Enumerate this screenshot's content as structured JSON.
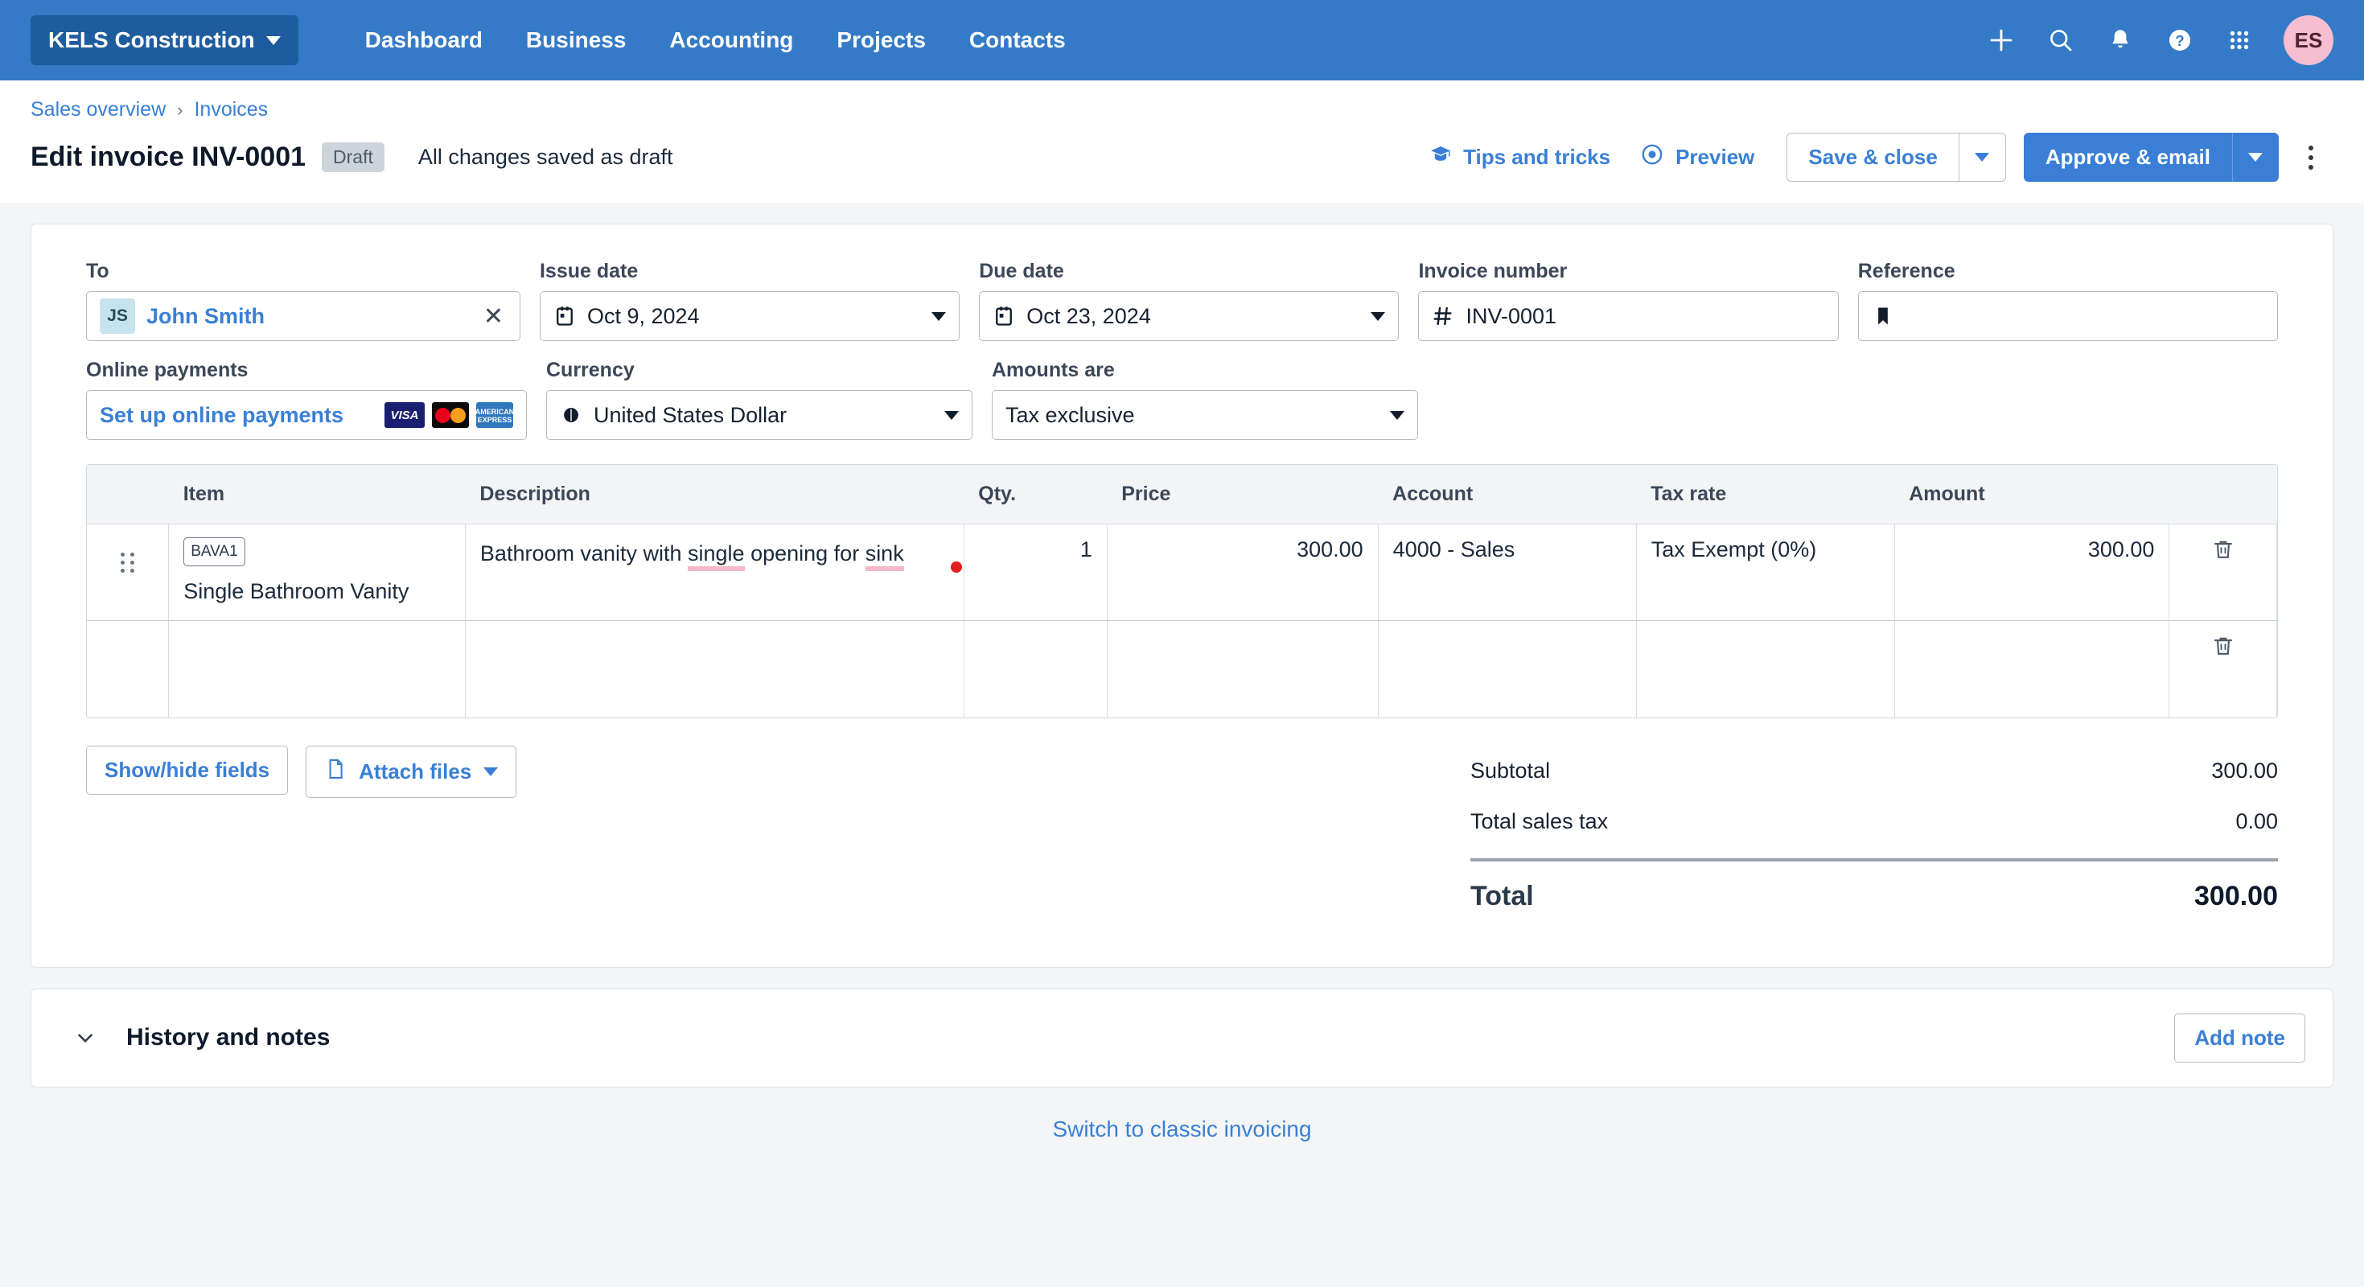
{
  "topnav": {
    "org_name": "KELS Construction",
    "links": [
      "Dashboard",
      "Business",
      "Accounting",
      "Projects",
      "Contacts"
    ],
    "icons": [
      "plus-icon",
      "search-icon",
      "notifications-bell-icon",
      "help-icon",
      "apps-grid-icon"
    ],
    "avatar_initials": "ES",
    "accent_bg": "#357ac6",
    "org_btn_bg": "#1f5c9e",
    "avatar_bg": "#f6bed0"
  },
  "header": {
    "breadcrumb": [
      "Sales overview",
      "Invoices"
    ],
    "breadcrumb_separator": "›",
    "title": "Edit invoice INV-0001",
    "status_badge": "Draft",
    "save_status": "All changes saved as draft",
    "tips_label": "Tips and tricks",
    "preview_label": "Preview",
    "save_close_label": "Save & close",
    "approve_email_label": "Approve & email"
  },
  "form": {
    "to": {
      "label": "To",
      "avatar_initials": "JS",
      "value": "John Smith",
      "clear": "✕"
    },
    "issue_date": {
      "label": "Issue date",
      "value": "Oct 9, 2024"
    },
    "due_date": {
      "label": "Due date",
      "value": "Oct 23, 2024"
    },
    "invoice_number": {
      "label": "Invoice number",
      "value": "INV-0001"
    },
    "reference": {
      "label": "Reference",
      "value": "",
      "placeholder": ""
    },
    "online_payments": {
      "label": "Online payments",
      "link": "Set up online payments",
      "cards": [
        "VISA",
        "Mastercard",
        "AMERICAN EXPRESS"
      ]
    },
    "currency": {
      "label": "Currency",
      "value": "United States Dollar"
    },
    "amounts_are": {
      "label": "Amounts are",
      "value": "Tax exclusive"
    }
  },
  "lines": {
    "headers": [
      "Item",
      "Description",
      "Qty.",
      "Price",
      "Account",
      "Tax rate",
      "Amount"
    ],
    "rows": [
      {
        "code": "BAVA1",
        "item": "Single Bathroom Vanity",
        "description_part1": "Bathroom vanity with ",
        "description_misspelled1": "single",
        "description_part2": " opening for ",
        "description_misspelled2": "sink",
        "qty": "1",
        "price": "300.00",
        "account": "4000 - Sales",
        "tax_rate": "Tax Exempt (0%)",
        "amount": "300.00"
      },
      {
        "code": "",
        "item": "",
        "description_part1": "",
        "description_misspelled1": "",
        "description_part2": "",
        "description_misspelled2": "",
        "qty": "",
        "price": "",
        "account": "",
        "tax_rate": "",
        "amount": ""
      }
    ]
  },
  "under_table": {
    "show_hide_fields": "Show/hide fields",
    "attach_files": "Attach files"
  },
  "totals": {
    "subtotal_label": "Subtotal",
    "subtotal_value": "300.00",
    "sales_tax_label": "Total sales tax",
    "sales_tax_value": "0.00",
    "total_label": "Total",
    "total_value": "300.00"
  },
  "history": {
    "title": "History and notes",
    "add_note_label": "Add note"
  },
  "footer": {
    "switch_link": "Switch to classic invoicing"
  }
}
